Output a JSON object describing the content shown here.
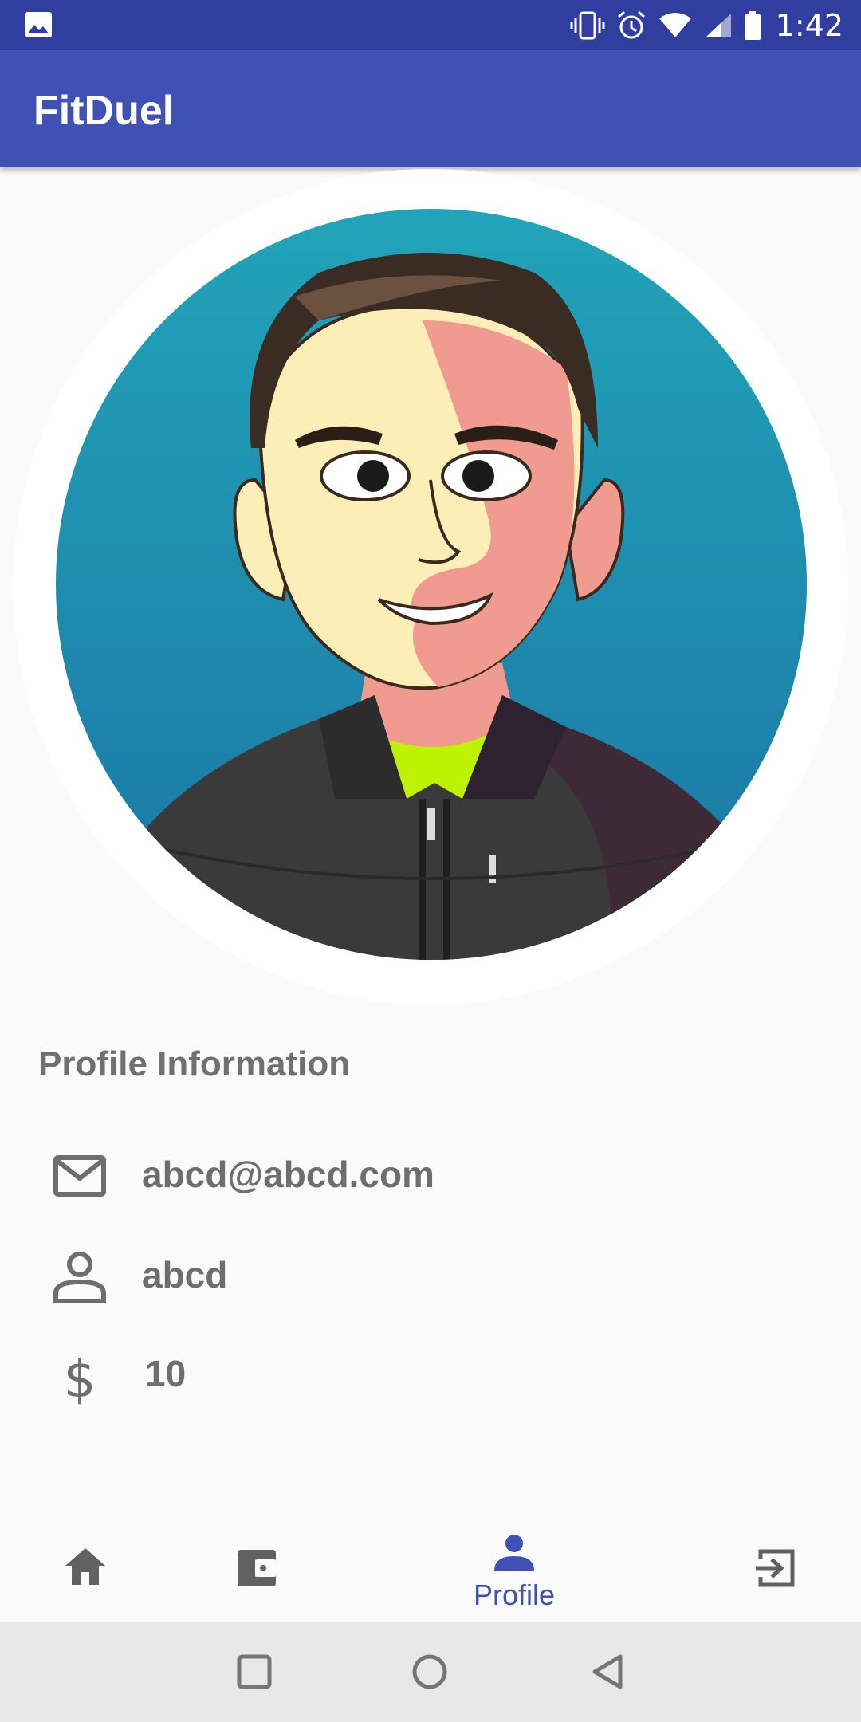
{
  "status_bar": {
    "time": "1:42",
    "icons": [
      "gallery-icon",
      "vibrate-icon",
      "alarm-icon",
      "wifi-icon",
      "signal-icon",
      "battery-icon"
    ]
  },
  "app_bar": {
    "title": "FitDuel"
  },
  "avatar": {
    "image": "cartoon-avatar-man-dark-jacket"
  },
  "profile": {
    "section_title": "Profile Information",
    "email": "abcd@abcd.com",
    "username": "abcd",
    "coins": "10"
  },
  "bottom_nav": {
    "items": [
      {
        "icon": "home-icon",
        "label": ""
      },
      {
        "icon": "wallet-icon",
        "label": ""
      },
      {
        "icon": "person-icon",
        "label": "Profile",
        "active": true
      },
      {
        "icon": "logout-icon",
        "label": ""
      }
    ]
  },
  "colors": {
    "primary": "#3f51b5",
    "primary_dark": "#303f9f",
    "text_gray": "#6e6e6e",
    "avatar_bg_top": "#20a3b8",
    "avatar_bg_bottom": "#1c7aa6"
  }
}
